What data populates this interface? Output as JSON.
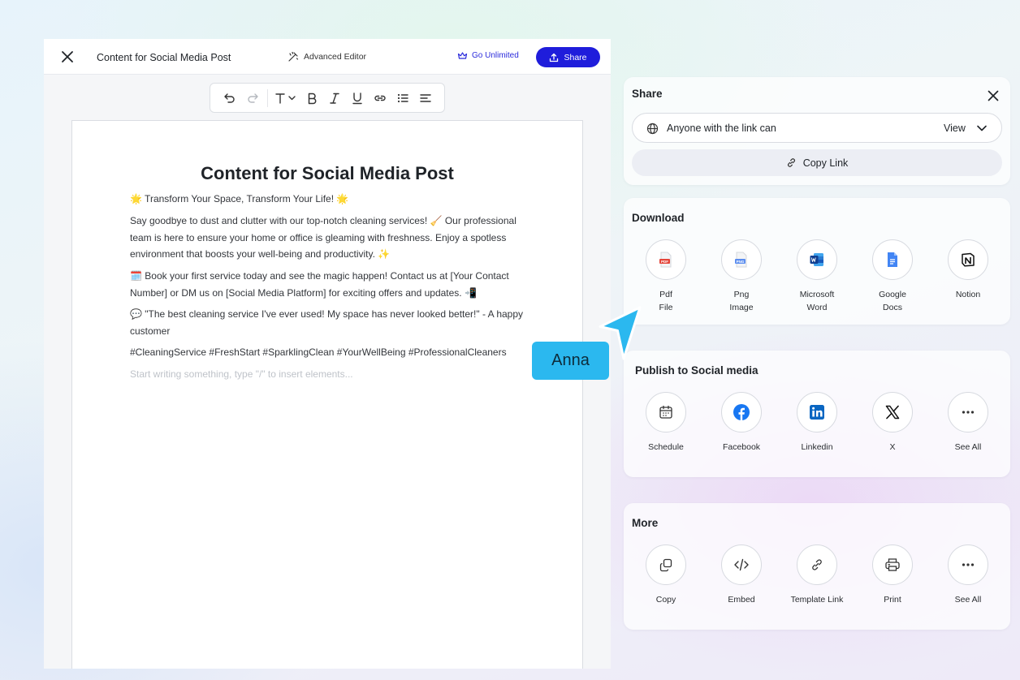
{
  "editor": {
    "doc_title": "Content for Social Media Post",
    "advanced_editor_label": "Advanced Editor",
    "go_unlimited_label": "Go Unlimited",
    "share_label": "Share",
    "toolbar": [
      "undo-icon",
      "redo-icon",
      "text-style-icon",
      "bold-icon",
      "italic-icon",
      "underline-icon",
      "link-icon",
      "bullet-list-icon",
      "align-left-icon"
    ]
  },
  "document": {
    "heading": "Content for Social Media Post",
    "paragraphs": [
      "🌟 Transform Your Space, Transform Your Life! 🌟",
      "Say goodbye to dust and clutter with our top-notch cleaning services! 🧹 Our professional team is here to ensure your home or office is gleaming with freshness. Enjoy a spotless environment that boosts your well-being and productivity. ✨",
      "🗓️ Book your first service today and see the magic happen! Contact us at [Your Contact Number] or DM us on [Social Media Platform] for exciting offers and updates. 📲",
      "💬 \"The best cleaning service I've ever used! My space has never looked better!\" - A happy customer",
      "#CleaningService #FreshStart #SparklingClean #YourWellBeing #ProfessionalCleaners"
    ],
    "placeholder": "Start writing something, type \"/\" to insert elements..."
  },
  "share_panel": {
    "title": "Share",
    "access_text": "Anyone with the link can",
    "access_value": "View",
    "copy_link_label": "Copy Link"
  },
  "download_panel": {
    "title": "Download",
    "items": [
      {
        "label": "Pdf\nFile",
        "icon": "pdf-icon"
      },
      {
        "label": "Png\nImage",
        "icon": "png-icon"
      },
      {
        "label": "Microsoft\nWord",
        "icon": "word-icon"
      },
      {
        "label": "Google\nDocs",
        "icon": "google-docs-icon"
      },
      {
        "label": "Notion",
        "icon": "notion-icon"
      }
    ]
  },
  "social_panel": {
    "title": "Publish to Social media",
    "items": [
      {
        "label": "Schedule",
        "icon": "calendar-icon"
      },
      {
        "label": "Facebook",
        "icon": "facebook-icon"
      },
      {
        "label": "Linkedin",
        "icon": "linkedin-icon"
      },
      {
        "label": "X",
        "icon": "x-icon"
      },
      {
        "label": "See All",
        "icon": "more-icon"
      }
    ]
  },
  "more_panel": {
    "title": "More",
    "items": [
      {
        "label": "Copy",
        "icon": "copy-icon"
      },
      {
        "label": "Embed",
        "icon": "embed-icon"
      },
      {
        "label": "Template Link",
        "icon": "link-icon"
      },
      {
        "label": "Print",
        "icon": "printer-icon"
      },
      {
        "label": "See All",
        "icon": "more-icon"
      }
    ]
  },
  "cursor": {
    "name": "Anna"
  },
  "colors": {
    "primary": "#1f1ddb",
    "cursor": "#2bb8ef"
  }
}
